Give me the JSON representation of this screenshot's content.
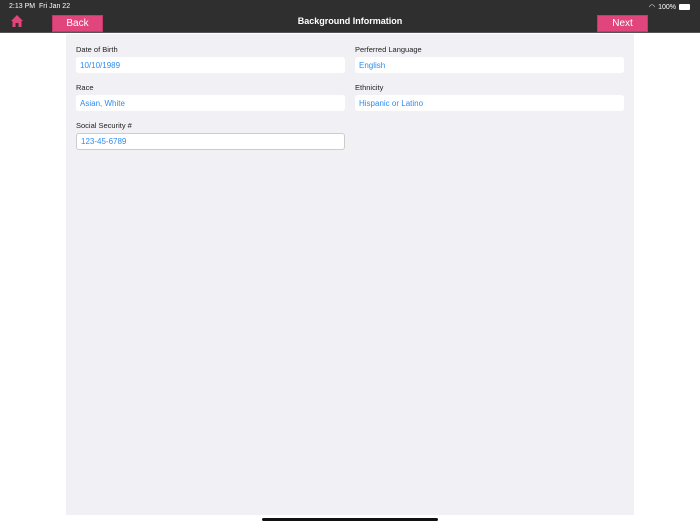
{
  "status": {
    "time": "2:13 PM",
    "date": "Fri Jan 22",
    "battery": "100%"
  },
  "header": {
    "title": "Background Information",
    "back_label": "Back",
    "next_label": "Next"
  },
  "form": {
    "dob": {
      "label": "Date of Birth",
      "value": "10/10/1989"
    },
    "language": {
      "label": "Perferred Language",
      "value": "English"
    },
    "race": {
      "label": "Race",
      "value": "Asian, White"
    },
    "ethnicity": {
      "label": "Ethnicity",
      "value": "Hispanic or Latino"
    },
    "ssn": {
      "label": "Social Security #",
      "value": "123-45-6789"
    }
  }
}
